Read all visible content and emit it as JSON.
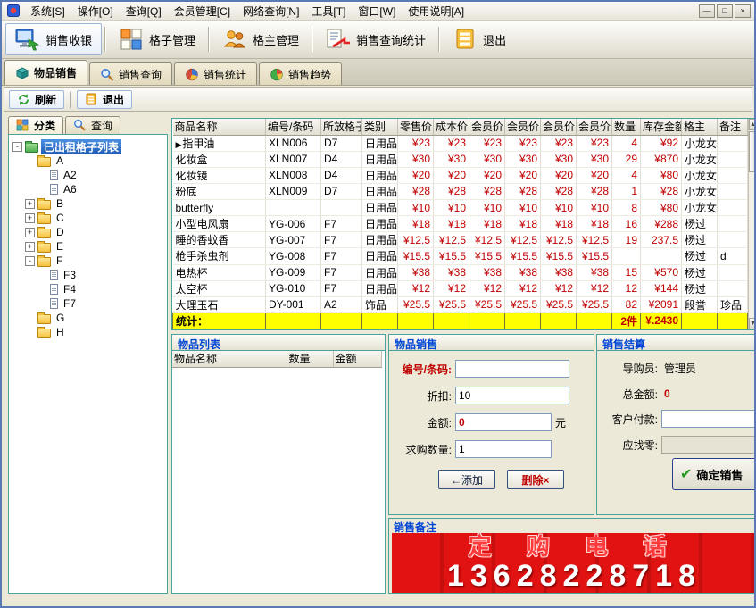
{
  "window": {
    "menu_items": [
      "系统[S]",
      "操作[O]",
      "查询[Q]",
      "会员管理[C]",
      "网络查询[N]",
      "工具[T]",
      "窗口[W]",
      "使用说明[A]"
    ],
    "controls": {
      "minimize": "—",
      "maximize": "□",
      "close": "×"
    }
  },
  "toolbar": {
    "buttons": [
      {
        "name": "sales-cashier-button",
        "icon": "cash-register-icon",
        "label": "销售收银",
        "highlight": true
      },
      {
        "name": "grid-manage-button",
        "icon": "grid-icon",
        "label": "格子管理"
      },
      {
        "name": "grid-owner-button",
        "icon": "owners-icon",
        "label": "格主管理"
      },
      {
        "name": "sales-query-stats-button",
        "icon": "stats-doc-icon",
        "label": "销售查询统计"
      },
      {
        "name": "exit-app-button",
        "icon": "exit-board-icon",
        "label": "退出"
      }
    ]
  },
  "tabs": [
    {
      "name": "tab-goods-sale",
      "icon": "package-icon",
      "label": "物品销售",
      "active": true
    },
    {
      "name": "tab-sales-query",
      "icon": "magnifier-icon",
      "label": "销售查询",
      "active": false
    },
    {
      "name": "tab-sales-stats",
      "icon": "pie-chart-icon",
      "label": "销售统计",
      "active": false
    },
    {
      "name": "tab-sales-trend",
      "icon": "trend-pie-icon",
      "label": "销售趋势",
      "active": false
    }
  ],
  "subtoolbar": {
    "refresh": "刷新",
    "exit": "退出"
  },
  "sidebar": {
    "tabs": [
      {
        "name": "sidebar-tab-category",
        "icon": "category-icon",
        "label": "分类",
        "active": true
      },
      {
        "name": "sidebar-tab-search",
        "icon": "search-icon",
        "label": "查询",
        "active": false
      }
    ],
    "tree_nodes": [
      {
        "label": "已出租格子列表",
        "level": 0,
        "type": "folder",
        "expander": "minus",
        "selected": true,
        "green": true
      },
      {
        "label": "A",
        "level": 1,
        "type": "folder",
        "expander": "none"
      },
      {
        "label": "A2",
        "level": 2,
        "type": "leaf"
      },
      {
        "label": "A6",
        "level": 2,
        "type": "leaf"
      },
      {
        "label": "B",
        "level": 1,
        "type": "folder",
        "expander": "plus"
      },
      {
        "label": "C",
        "level": 1,
        "type": "folder",
        "expander": "plus"
      },
      {
        "label": "D",
        "level": 1,
        "type": "folder",
        "expander": "plus"
      },
      {
        "label": "E",
        "level": 1,
        "type": "folder",
        "expander": "plus"
      },
      {
        "label": "F",
        "level": 1,
        "type": "folder",
        "expander": "minus"
      },
      {
        "label": "F3",
        "level": 2,
        "type": "leaf"
      },
      {
        "label": "F4",
        "level": 2,
        "type": "leaf"
      },
      {
        "label": "F7",
        "level": 2,
        "type": "leaf"
      },
      {
        "label": "G",
        "level": 1,
        "type": "folder",
        "expander": "none"
      },
      {
        "label": "H",
        "level": 1,
        "type": "folder",
        "expander": "none"
      }
    ]
  },
  "product_table": {
    "columns": [
      "商品名称",
      "编号/条码",
      "所放格子",
      "类别",
      "零售价",
      "成本价",
      "会员价",
      "会员价",
      "会员价",
      "会员价",
      "数量",
      "库存金额",
      "格主",
      "备注"
    ],
    "rows": [
      {
        "selected": true,
        "cells": [
          "指甲油",
          "XLN006",
          "D7",
          "日用品",
          "¥23",
          "¥23",
          "¥23",
          "¥23",
          "¥23",
          "¥23",
          "4",
          "¥92",
          "小龙女",
          ""
        ]
      },
      {
        "cells": [
          "化妆盒",
          "XLN007",
          "D4",
          "日用品",
          "¥30",
          "¥30",
          "¥30",
          "¥30",
          "¥30",
          "¥30",
          "29",
          "¥870",
          "小龙女",
          ""
        ]
      },
      {
        "cells": [
          "化妆镜",
          "XLN008",
          "D4",
          "日用品",
          "¥20",
          "¥20",
          "¥20",
          "¥20",
          "¥20",
          "¥20",
          "4",
          "¥80",
          "小龙女",
          ""
        ]
      },
      {
        "cells": [
          "粉底",
          "XLN009",
          "D7",
          "日用品",
          "¥28",
          "¥28",
          "¥28",
          "¥28",
          "¥28",
          "¥28",
          "1",
          "¥28",
          "小龙女",
          ""
        ]
      },
      {
        "cells": [
          "butterfly",
          "",
          "",
          "日用品",
          "¥10",
          "¥10",
          "¥10",
          "¥10",
          "¥10",
          "¥10",
          "8",
          "¥80",
          "小龙女",
          ""
        ]
      },
      {
        "cells": [
          "小型电风扇",
          "YG-006",
          "F7",
          "日用品",
          "¥18",
          "¥18",
          "¥18",
          "¥18",
          "¥18",
          "¥18",
          "16",
          "¥288",
          "杨过",
          ""
        ]
      },
      {
        "cells": [
          "睡的香蚊香",
          "YG-007",
          "F7",
          "日用品",
          "¥12.5",
          "¥12.5",
          "¥12.5",
          "¥12.5",
          "¥12.5",
          "¥12.5",
          "19",
          "237.5",
          "杨过",
          ""
        ]
      },
      {
        "cells": [
          "枪手杀虫剂",
          "YG-008",
          "F7",
          "日用品",
          "¥15.5",
          "¥15.5",
          "¥15.5",
          "¥15.5",
          "¥15.5",
          "¥15.5",
          "",
          "",
          "杨过",
          "d"
        ]
      },
      {
        "cells": [
          "电热杯",
          "YG-009",
          "F7",
          "日用品",
          "¥38",
          "¥38",
          "¥38",
          "¥38",
          "¥38",
          "¥38",
          "15",
          "¥570",
          "杨过",
          ""
        ]
      },
      {
        "cells": [
          "太空杯",
          "YG-010",
          "F7",
          "日用品",
          "¥12",
          "¥12",
          "¥12",
          "¥12",
          "¥12",
          "¥12",
          "12",
          "¥144",
          "杨过",
          ""
        ]
      },
      {
        "cells": [
          "大理玉石",
          "DY-001",
          "A2",
          "饰品",
          "¥25.5",
          "¥25.5",
          "¥25.5",
          "¥25.5",
          "¥25.5",
          "¥25.5",
          "82",
          "¥2091",
          "段誉",
          "珍品"
        ]
      }
    ],
    "stats": {
      "label": "统计：",
      "quantity": "2件",
      "amount": "¥.2430"
    }
  },
  "item_list": {
    "title": "物品列表",
    "columns": [
      "物品名称",
      "数量",
      "金额"
    ]
  },
  "item_sale": {
    "title": "物品销售",
    "fields": [
      {
        "name": "barcode-input",
        "label": "编号/条码:",
        "value": "",
        "label_red": true
      },
      {
        "name": "discount-input",
        "label": "折扣:",
        "value": "10"
      },
      {
        "name": "amount-input",
        "label": "金额:",
        "value": "0",
        "value_red": true,
        "suffix": "元"
      },
      {
        "name": "quantity-input",
        "label": "求购数量:",
        "value": "1"
      }
    ],
    "buttons": {
      "add": "←添加",
      "delete": "删除×"
    }
  },
  "settlement": {
    "title": "销售结算",
    "fields": [
      {
        "name": "salesperson-field",
        "label": "导购员:",
        "value": "管理员",
        "type": "text"
      },
      {
        "name": "total-amount-field",
        "label": "总金额:",
        "value": "0",
        "type": "text",
        "value_red": true
      },
      {
        "name": "customer-payment-input",
        "label": "客户付款:",
        "value": "",
        "type": "input"
      },
      {
        "name": "change-due-field",
        "label": "应找零:",
        "value": "",
        "type": "flat"
      }
    ],
    "confirm_icon": "✔",
    "confirm_button": "确定销售"
  },
  "remarks": {
    "title": "销售备注",
    "banner_line1": "定 购 电 话",
    "banner_line2": "13628228718"
  },
  "colors": {
    "accent_teal": "#4aa39b",
    "price_red": "#c00000",
    "stats_yellow": "#ffff00",
    "banner_red": "#dd1111",
    "header_blue": "#0046d5"
  }
}
